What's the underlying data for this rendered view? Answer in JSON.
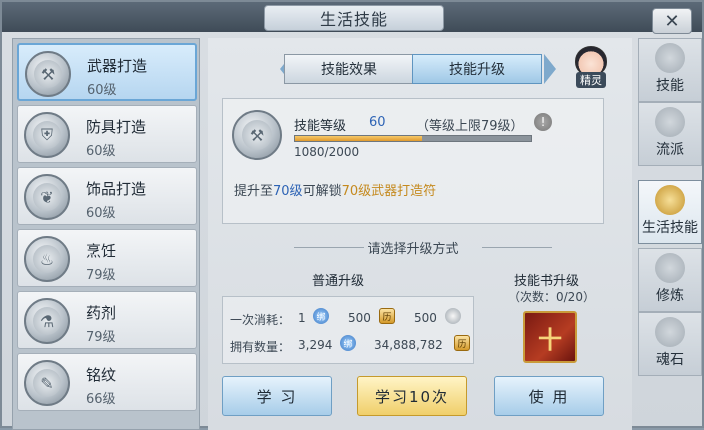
{
  "window": {
    "title": "生活技能",
    "close_symbol": "✕"
  },
  "skills": [
    {
      "name": "武器打造",
      "level": "60级",
      "icon": "weapon-craft-icon",
      "selected": true
    },
    {
      "name": "防具打造",
      "level": "60级",
      "icon": "armor-craft-icon",
      "selected": false
    },
    {
      "name": "饰品打造",
      "level": "60级",
      "icon": "accessory-craft-icon",
      "selected": false
    },
    {
      "name": "烹饪",
      "level": "79级",
      "icon": "cooking-icon",
      "selected": false
    },
    {
      "name": "药剂",
      "level": "79级",
      "icon": "potion-icon",
      "selected": false
    },
    {
      "name": "铭纹",
      "level": "66级",
      "icon": "inscription-icon",
      "selected": false
    }
  ],
  "tabs": {
    "effect": "技能效果",
    "upgrade": "技能升级"
  },
  "sprite": {
    "label": "精灵"
  },
  "detail": {
    "level_label": "技能等级",
    "level_value": "60",
    "level_cap": "（等级上限79级）",
    "warn_symbol": "!",
    "xp_current": 1080,
    "xp_max": 2000,
    "xp_text": "1080/2000",
    "unlock_prefix": "提升至",
    "unlock_level": "70级",
    "unlock_middle": "可解锁",
    "unlock_item": "70级武器打造符"
  },
  "upgrade": {
    "divider": "请选择升级方式",
    "normal_title": "普通升级",
    "cost_label": "一次消耗：",
    "cost_item1": "1",
    "cost_item2": "500",
    "cost_item3": "500",
    "owned_label": "拥有数量：",
    "owned_item1": "3,294",
    "owned_item2": "34,888,782",
    "coin_mark": "历",
    "bind_mark": "绑",
    "book_title": "技能书升级",
    "book_count": "（次数：0/20）",
    "book_glyph": "十"
  },
  "buttons": {
    "learn": "学 习",
    "learn10": "学习10次",
    "use": "使 用"
  },
  "right_tabs": [
    {
      "label": "技能",
      "active": false
    },
    {
      "label": "流派",
      "active": false
    },
    {
      "label": "生活技能",
      "active": true
    },
    {
      "label": "修炼",
      "active": false
    },
    {
      "label": "魂石",
      "active": false
    }
  ]
}
